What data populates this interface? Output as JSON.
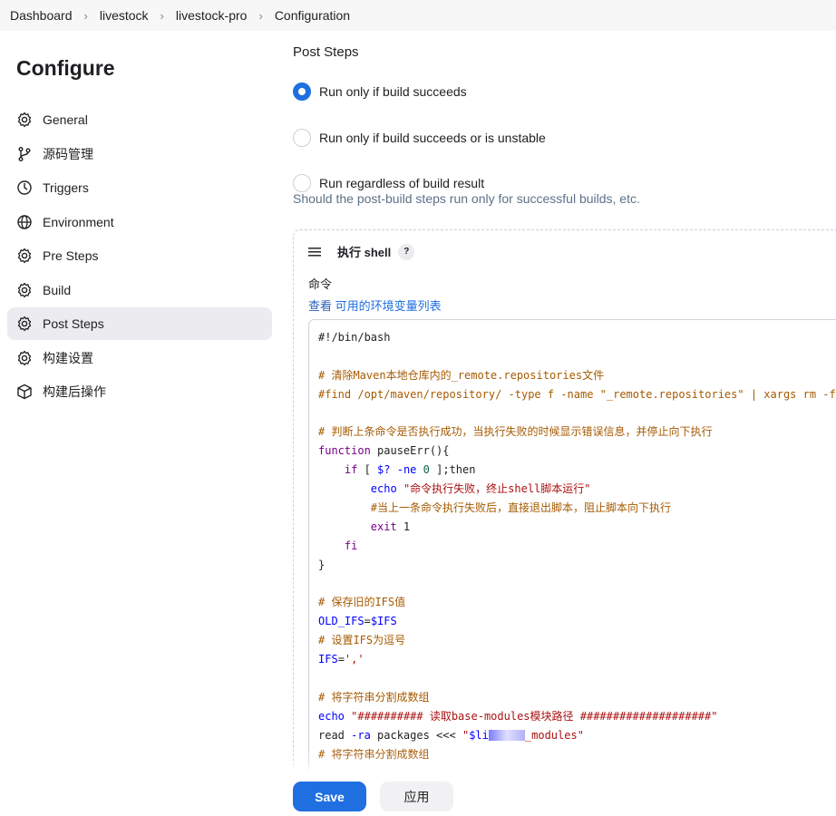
{
  "breadcrumb": [
    "Dashboard",
    "livestock",
    "livestock-pro",
    "Configuration"
  ],
  "sidebar": {
    "title": "Configure",
    "items": [
      {
        "label": "General",
        "icon": "gear-icon"
      },
      {
        "label": "源码管理",
        "icon": "branch-icon"
      },
      {
        "label": "Triggers",
        "icon": "timer-icon"
      },
      {
        "label": "Environment",
        "icon": "globe-icon"
      },
      {
        "label": "Pre Steps",
        "icon": "gear-icon"
      },
      {
        "label": "Build",
        "icon": "gear-icon"
      },
      {
        "label": "Post Steps",
        "icon": "gear-icon",
        "active": true
      },
      {
        "label": "构建设置",
        "icon": "gear-icon"
      },
      {
        "label": "构建后操作",
        "icon": "package-icon"
      }
    ]
  },
  "main": {
    "heading": "Post Steps",
    "radios": [
      {
        "label": "Run only if build succeeds",
        "checked": true
      },
      {
        "label": "Run only if build succeeds or is unstable",
        "checked": false
      },
      {
        "label": "Run regardless of build result",
        "checked": false
      }
    ],
    "help": "Should the post-build steps run only for successful builds, etc.",
    "step": {
      "title": "执行 shell",
      "help_badge": "?",
      "command_label": "命令",
      "env_prefix": "查看 ",
      "env_link": "可用的环境变量列表",
      "code": [
        [
          [
            "def",
            "#!/bin/bash"
          ]
        ],
        [],
        [
          [
            "comment",
            "# 清除Maven本地仓库内的_remote.repositories文件"
          ]
        ],
        [
          [
            "comment",
            "#find /opt/maven/repository/ -type f -name \"_remote.repositories\" | xargs rm -f"
          ]
        ],
        [],
        [
          [
            "comment",
            "# 判断上条命令是否执行成功，当执行失败的时候显示错误信息，并停止向下执行"
          ]
        ],
        [
          [
            "kw",
            "function"
          ],
          [
            "def",
            " pauseErr(){"
          ]
        ],
        [
          [
            "def",
            "    "
          ],
          [
            "kw",
            "if"
          ],
          [
            "def",
            " [ "
          ],
          [
            "var",
            "$?"
          ],
          [
            "def",
            " "
          ],
          [
            "var",
            "-ne"
          ],
          [
            "def",
            " "
          ],
          [
            "num",
            "0"
          ],
          [
            "def",
            " ];then"
          ]
        ],
        [
          [
            "def",
            "        "
          ],
          [
            "var",
            "echo"
          ],
          [
            "def",
            " "
          ],
          [
            "str",
            "\"命令执行失败，终止shell脚本运行\""
          ]
        ],
        [
          [
            "def",
            "        "
          ],
          [
            "comment",
            "#当上一条命令执行失败后，直接退出脚本，阻止脚本向下执行"
          ]
        ],
        [
          [
            "def",
            "        "
          ],
          [
            "kw",
            "exit"
          ],
          [
            "def",
            " 1"
          ]
        ],
        [
          [
            "def",
            "    "
          ],
          [
            "kw",
            "fi"
          ]
        ],
        [
          [
            "def",
            "}"
          ]
        ],
        [],
        [
          [
            "comment",
            "# 保存旧的IFS值"
          ]
        ],
        [
          [
            "var",
            "OLD_IFS"
          ],
          [
            "def",
            "="
          ],
          [
            "var",
            "$IFS"
          ]
        ],
        [
          [
            "comment",
            "# 设置IFS为逗号"
          ]
        ],
        [
          [
            "var",
            "IFS"
          ],
          [
            "def",
            "="
          ],
          [
            "str",
            "','"
          ]
        ],
        [],
        [
          [
            "comment",
            "# 将字符串分割成数组"
          ]
        ],
        [
          [
            "var",
            "echo"
          ],
          [
            "def",
            " "
          ],
          [
            "str",
            "\"########## 读取base-modules模块路径 ####################\""
          ]
        ],
        [
          [
            "def",
            "read "
          ],
          [
            "var",
            "-ra"
          ],
          [
            "def",
            " packages <<< "
          ],
          [
            "str",
            "\""
          ],
          [
            "var",
            "$li"
          ],
          [
            "blur",
            ""
          ],
          [
            "str",
            "_modules\""
          ]
        ],
        [
          [
            "comment",
            "# 将字符串分割成数组"
          ]
        ]
      ]
    }
  },
  "actions": {
    "save": "Save",
    "apply": "应用"
  },
  "colors": {
    "accent": "#1f6fe0",
    "comment": "#a65a00",
    "keyword": "#770088",
    "variable": "#0000ff",
    "string": "#aa1111"
  }
}
